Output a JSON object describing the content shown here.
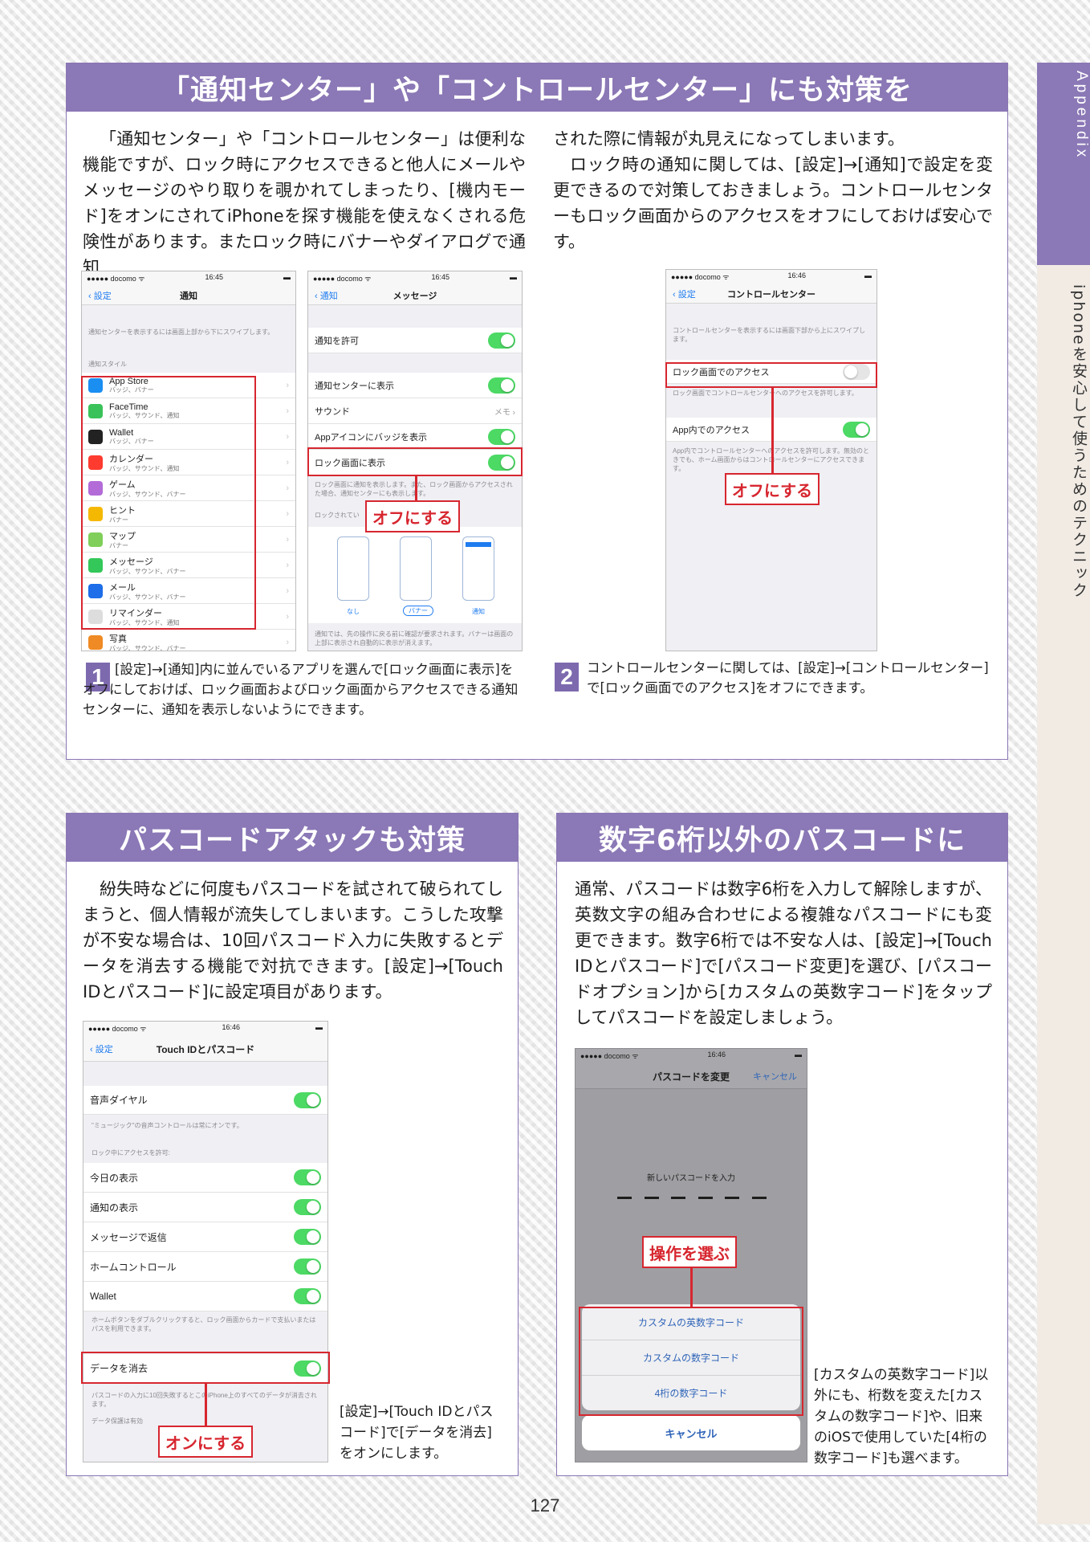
{
  "side_tab": {
    "appendix": "Appendix",
    "section": "iphoneを安心して使うためのテクニック"
  },
  "section1": {
    "title": "「通知センター」や「コントロールセンター」にも対策を",
    "para_a": "「通知センター」や「コントロールセンター」は便利な機能ですが、ロック時にアクセスできると他人にメールやメッセージのやり取りを覗かれてしまったり、[機内モード]をオンにされてiPhoneを探す機能を使えなくされる危険性があります。またロック時にバナーやダイアログで通知",
    "para_b1": "された際に情報が丸見えになってしまいます。",
    "para_b2": "ロック時の通知に関しては、[設定]→[通知]で設定を変更できるので対策しておきましょう。コントロールセンターもロック画面からのアクセスをオフにしておけば安心です。",
    "phone_a": {
      "status_left": "●●●●● docomo ᯤ",
      "status_time": "16:45",
      "back": "設定",
      "title": "通知",
      "note": "通知センターを表示するには画面上部から下にスワイプします。",
      "group": "通知スタイル",
      "apps": [
        {
          "name": "App Store",
          "sub": "バッジ、バナー",
          "color": "#1b8ef2"
        },
        {
          "name": "FaceTime",
          "sub": "バッジ、サウンド、通知",
          "color": "#3ac25a"
        },
        {
          "name": "Wallet",
          "sub": "バッジ、バナー",
          "color": "#222222"
        },
        {
          "name": "カレンダー",
          "sub": "バッジ、サウンド、通知",
          "color": "#ff3b30"
        },
        {
          "name": "ゲーム",
          "sub": "バッジ、サウンド、バナー",
          "color": "#b36bd8"
        },
        {
          "name": "ヒント",
          "sub": "バナー",
          "color": "#f5b800"
        },
        {
          "name": "マップ",
          "sub": "バナー",
          "color": "#7fcf5a"
        },
        {
          "name": "メッセージ",
          "sub": "バッジ、サウンド、バナー",
          "color": "#34c759"
        },
        {
          "name": "メール",
          "sub": "バッジ、サウンド、バナー",
          "color": "#1d6ee8"
        },
        {
          "name": "リマインダー",
          "sub": "バッジ、サウンド、通知",
          "color": "#dddddd"
        },
        {
          "name": "写真",
          "sub": "バッジ、サウンド、バナー",
          "color": "#f08a24"
        }
      ]
    },
    "phone_b": {
      "status_left": "●●●●● docomo ᯤ",
      "status_time": "16:45",
      "back": "通知",
      "title": "メッセージ",
      "allow": "通知を許可",
      "show_center": "通知センターに表示",
      "sound": "サウンド",
      "sound_value": "メモ",
      "badge": "Appアイコンにバッジを表示",
      "lockscreen": "ロック画面に表示",
      "note1": "ロック画面に通知を表示します。また、ロック画面からアクセスされた場合、通知センターにも表示します。",
      "locked_label": "ロックされてい",
      "opt_none": "なし",
      "opt_banner": "バナー",
      "opt_alert": "通知",
      "note2": "通知では、先の操作に戻る前に確認が要求されます。バナーは画面の上部に表示され自動的に表示が消えます。"
    },
    "callout_a": "オフにする",
    "cap1_num": "1",
    "cap1": "[設定]→[通知]内に並んでいるアプリを選んで[ロック画面に表示]をオフにしておけば、ロック画面およびロック画面からアクセスできる通知センターに、通知を表示しないようにできます。",
    "phone_c": {
      "status_left": "●●●●● docomo ᯤ",
      "status_time": "16:46",
      "back": "設定",
      "title": "コントロールセンター",
      "note1": "コントロールセンターを表示するには画面下部から上にスワイプします。",
      "lock_access": "ロック画面でのアクセス",
      "note2": "ロック画面でコントロールセンターへのアクセスを許可します。",
      "app_access": "App内でのアクセス",
      "note3": "App内でコントロールセンターへのアクセスを許可します。無効のときでも、ホーム画面からはコントロールセンターにアクセスできます。"
    },
    "callout_c": "オフにする",
    "cap2_num": "2",
    "cap2": "コントロールセンターに関しては、[設定]→[コントロールセンター]で[ロック画面でのアクセス]をオフにできます。"
  },
  "section2": {
    "title": "パスコードアタックも対策",
    "para": "紛失時などに何度もパスコードを試されて破られてしまうと、個人情報が流失してしまいます。こうした攻撃が不安な場合は、10回パスコード入力に失敗するとデータを消去する機能で対抗できます。[設定]→[Touch IDとパスコード]に設定項目があります。",
    "phone": {
      "status_left": "●●●●● docomo ᯤ",
      "status_time": "16:46",
      "back": "設定",
      "title": "Touch IDとパスコード",
      "voice_dial": "音声ダイヤル",
      "note1": "\"ミュージック\"の音声コントロールは常にオンです。",
      "group": "ロック中にアクセスを許可:",
      "items": [
        "今日の表示",
        "通知の表示",
        "メッセージで返信",
        "ホームコントロール",
        "Wallet"
      ],
      "note2": "ホームボタンをダブルクリックすると、ロック画面からカードで支払いまたはパスを利用できます。",
      "erase": "データを消去",
      "note3": "パスコードの入力に10回失敗するとこのiPhone上のすべてのデータが消去されます。",
      "note4": "データ保護は有効"
    },
    "callout": "オンにする",
    "caption": "[設定]→[Touch IDとパスコード]で[データを消去]をオンにします。"
  },
  "section3": {
    "title": "数字6桁以外のパスコードに",
    "para": "通常、パスコードは数字6桁を入力して解除しますが、英数文字の組み合わせによる複雑なパスコードにも変更できます。数字6桁では不安な人は、[設定]→[Touch IDとパスコード]で[パスコード変更]を選び、[パスコードオプション]から[カスタムの英数字コード]をタップしてパスコードを設定しましょう。",
    "phone": {
      "status_left": "●●●●● docomo ᯤ",
      "status_time": "16:46",
      "title": "パスコードを変更",
      "cancel_link": "キャンセル",
      "prompt": "新しいパスコードを入力",
      "options": [
        "カスタムの英数字コード",
        "カスタムの数字コード",
        "4桁の数字コード"
      ],
      "cancel": "キャンセル"
    },
    "callout": "操作を選ぶ",
    "caption": "[カスタムの英数字コード]以外にも、桁数を変えた[カスタムの数字コード]や、旧来のiOSで使用していた[4桁の数字コード]も選べます。"
  },
  "page_number": "127",
  "colors": {
    "accent": "#8b78b6",
    "highlight": "#d7262f",
    "toggle_on": "#4cd964",
    "ios_blue": "#1f7cf0"
  }
}
